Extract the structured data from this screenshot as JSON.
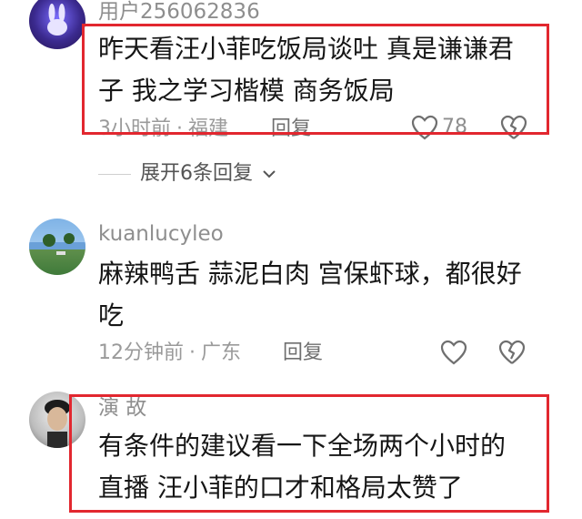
{
  "comments": [
    {
      "username": "用户256062836",
      "text": "昨天看汪小菲吃饭局谈吐 真是谦谦君子 我之学习楷模  商务饭局",
      "time": "3小时前",
      "location": "福建",
      "reply_label": "回复",
      "like_count": "78"
    },
    {
      "username": "kuanlucyleo",
      "text": "麻辣鸭舌 蒜泥白肉  宫保虾球，都很好吃",
      "time": "12分钟前",
      "location": "广东",
      "reply_label": "回复",
      "like_count": ""
    },
    {
      "username": "演   故",
      "text": "有条件的建议看一下全场两个小时的直播 汪小菲的口才和格局太赞了",
      "time": "",
      "location": "",
      "reply_label": "",
      "like_count": ""
    }
  ],
  "expand_replies_label": "展开6条回复",
  "icons": {
    "like": "heart-outline-icon",
    "dislike": "broken-heart-icon",
    "expand": "chevron-down-icon"
  },
  "colors": {
    "highlight": "#e2272f",
    "meta_text": "#9a9a9a"
  }
}
